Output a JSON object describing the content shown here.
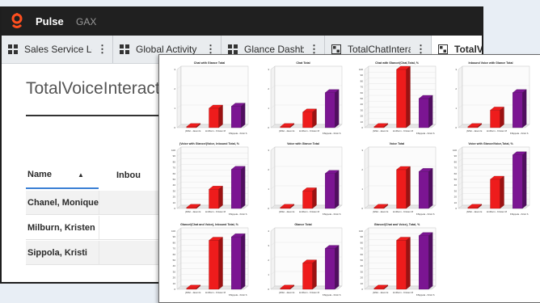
{
  "app": {
    "name": "Pulse",
    "org": "GAX"
  },
  "colors": {
    "bar_red": "#ee1c1c",
    "bar_purple": "#7b1592",
    "topbar": "#202020",
    "accent": "#3a7fd4"
  },
  "tabs": [
    {
      "label": "Sales Service Leve",
      "icon": "dashboard-grid-icon",
      "active": false
    },
    {
      "label": "Global Activity",
      "icon": "dashboard-grid-icon",
      "active": false
    },
    {
      "label": "Glance Dashboard",
      "icon": "dashboard-grid-icon",
      "active": false
    },
    {
      "label": "TotalChatInteracti",
      "icon": "widget-icon",
      "active": false
    },
    {
      "label": "TotalVo",
      "icon": "widget-icon",
      "active": true
    }
  ],
  "page": {
    "title": "TotalVoiceInteraction"
  },
  "table": {
    "columns": [
      "Name",
      "Inbou"
    ],
    "rows": [
      "Chanel, Monique",
      "Milburn, Kristen",
      "Sippola, Kristi"
    ]
  },
  "chart_data": [
    {
      "type": "bar",
      "title": "Chat with Glance Total",
      "categories": [
        "jbiffel - Jason E",
        "kmilburn - Kristen M",
        "KSippola - Kristi S"
      ],
      "values": [
        0,
        1,
        1.1
      ],
      "ylim": [
        0,
        3
      ]
    },
    {
      "type": "bar",
      "title": "Chat Total",
      "categories": [
        "jbiffel - Jason E",
        "kmilburn - Kristen M",
        "KSippola - Kristi S"
      ],
      "values": [
        0,
        0.8,
        1.8
      ],
      "ylim": [
        0,
        3
      ]
    },
    {
      "type": "bar",
      "title": "Chat with Glance/(Chat,Total, %",
      "categories": [
        "jbiffel - Jason E",
        "kmilburn - Kristen M",
        "KSippola - Kristi S"
      ],
      "values": [
        0,
        100,
        50
      ],
      "ylim": [
        0,
        100
      ]
    },
    {
      "type": "bar",
      "title": "Inbound Voice with Glance Total",
      "categories": [
        "jbiffel - Jason E",
        "kmilburn - Kristen M",
        "KSippola - Kristi S"
      ],
      "values": [
        0,
        0.9,
        1.8
      ],
      "ylim": [
        0,
        3
      ]
    },
    {
      "type": "bar",
      "title": "(Voice with Glance/(Voice, Inbound Total, %",
      "categories": [
        "jbiffel - Jason E",
        "kmilburn - Kristen M",
        "KSippola - Kristi S"
      ],
      "values": [
        0,
        33,
        67
      ],
      "ylim": [
        0,
        100
      ]
    },
    {
      "type": "bar",
      "title": "Voice with Glance Total",
      "categories": [
        "jbiffel - Jason E",
        "kmilburn - Kristen M",
        "KSippola - Kristi S"
      ],
      "values": [
        0,
        0.9,
        1.8
      ],
      "ylim": [
        0,
        3
      ]
    },
    {
      "type": "bar",
      "title": "Voice Total",
      "categories": [
        "jbiffel - Jason E",
        "kmilburn - Kristen M",
        "KSippola - Kristi S"
      ],
      "values": [
        0,
        2,
        1.9
      ],
      "ylim": [
        0,
        3
      ]
    },
    {
      "type": "bar",
      "title": "Voice with Glance/Voice,Total, %",
      "categories": [
        "jbiffel - Jason E",
        "kmilburn - Kristen M",
        "KSippola - Kristi S"
      ],
      "values": [
        0,
        50,
        92
      ],
      "ylim": [
        0,
        100
      ]
    },
    {
      "type": "bar",
      "title": "Glance/(Chat and Voice), Inbound Total, %",
      "categories": [
        "jbiffel - Jason E",
        "kmilburn - Kristen M",
        "KSippola - Kristi S"
      ],
      "values": [
        0,
        84,
        90
      ],
      "ylim": [
        0,
        100
      ]
    },
    {
      "type": "bar",
      "title": "Glance Total",
      "categories": [
        "jbiffel - Jason E",
        "kmilburn - Kristen M",
        "KSippola - Kristi S"
      ],
      "values": [
        0,
        1.8,
        2.8
      ],
      "ylim": [
        0,
        4
      ]
    },
    {
      "type": "bar",
      "title": "Glance/(Chat and Voice), Total, %",
      "categories": [
        "jbiffel - Jason E",
        "kmilburn - Kristen M",
        "KSippola - Kristi S"
      ],
      "values": [
        0,
        84,
        92
      ],
      "ylim": [
        0,
        100
      ]
    }
  ]
}
